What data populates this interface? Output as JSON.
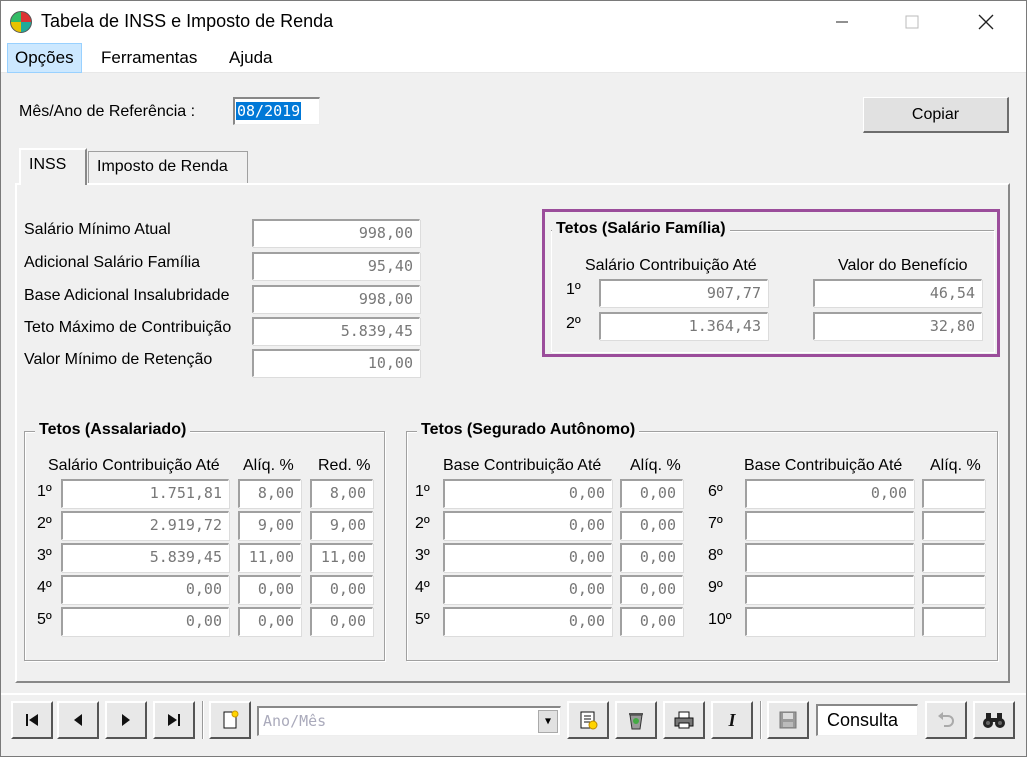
{
  "window": {
    "title": "Tabela de INSS e Imposto de Renda"
  },
  "menu": {
    "items": [
      "Opções",
      "Ferramentas",
      "Ajuda"
    ]
  },
  "reference": {
    "label": "Mês/Ano de Referência :",
    "value": "08/2019"
  },
  "copy_button": {
    "label": "Copiar"
  },
  "tabs": [
    "INSS",
    "Imposto de Renda"
  ],
  "inss_fields": [
    {
      "label": "Salário Mínimo Atual",
      "value": "998,00"
    },
    {
      "label": "Adicional Salário Família",
      "value": "95,40"
    },
    {
      "label": "Base Adicional Insalubridade",
      "value": "998,00"
    },
    {
      "label": "Teto Máximo de Contribuição",
      "value": "5.839,45"
    },
    {
      "label": "Valor Mínimo de Retenção",
      "value": "10,00"
    }
  ],
  "salario_familia": {
    "title": "Tetos (Salário Família)",
    "col1": "Salário Contribuição Até",
    "col2": "Valor do Benefício",
    "rows": [
      {
        "idx": "1º",
        "contrib": "907,77",
        "beneficio": "46,54"
      },
      {
        "idx": "2º",
        "contrib": "1.364,43",
        "beneficio": "32,80"
      }
    ]
  },
  "assalariado": {
    "title": "Tetos (Assalariado)",
    "col1": "Salário Contribuição Até",
    "col2": "Alíq. %",
    "col3": "Red. %",
    "rows": [
      {
        "idx": "1º",
        "contrib": "1.751,81",
        "aliq": "8,00",
        "red": "8,00"
      },
      {
        "idx": "2º",
        "contrib": "2.919,72",
        "aliq": "9,00",
        "red": "9,00"
      },
      {
        "idx": "3º",
        "contrib": "5.839,45",
        "aliq": "11,00",
        "red": "11,00"
      },
      {
        "idx": "4º",
        "contrib": "0,00",
        "aliq": "0,00",
        "red": "0,00"
      },
      {
        "idx": "5º",
        "contrib": "0,00",
        "aliq": "0,00",
        "red": "0,00"
      }
    ]
  },
  "autonomo": {
    "title": "Tetos (Segurado Autônomo)",
    "col1": "Base Contribuição Até",
    "col2": "Alíq. %",
    "col3": "Base Contribuição Até",
    "col4": "Alíq. %",
    "left": [
      {
        "idx": "1º",
        "base": "0,00",
        "aliq": "0,00"
      },
      {
        "idx": "2º",
        "base": "0,00",
        "aliq": "0,00"
      },
      {
        "idx": "3º",
        "base": "0,00",
        "aliq": "0,00"
      },
      {
        "idx": "4º",
        "base": "0,00",
        "aliq": "0,00"
      },
      {
        "idx": "5º",
        "base": "0,00",
        "aliq": "0,00"
      }
    ],
    "right": [
      {
        "idx": "6º",
        "base": "0,00",
        "aliq": ""
      },
      {
        "idx": "7º",
        "base": "",
        "aliq": ""
      },
      {
        "idx": "8º",
        "base": "",
        "aliq": ""
      },
      {
        "idx": "9º",
        "base": "",
        "aliq": ""
      },
      {
        "idx": "10º",
        "base": "",
        "aliq": ""
      }
    ]
  },
  "toolbar": {
    "combo_placeholder": "Ano/Mês",
    "mode": "Consulta",
    "icons": [
      "first-record-icon",
      "prev-record-icon",
      "next-record-icon",
      "last-record-icon",
      "new-record-icon",
      "report-icon",
      "delete-icon",
      "print-icon",
      "italic-icon",
      "save-icon",
      "undo-icon",
      "search-binoculars-icon"
    ]
  }
}
